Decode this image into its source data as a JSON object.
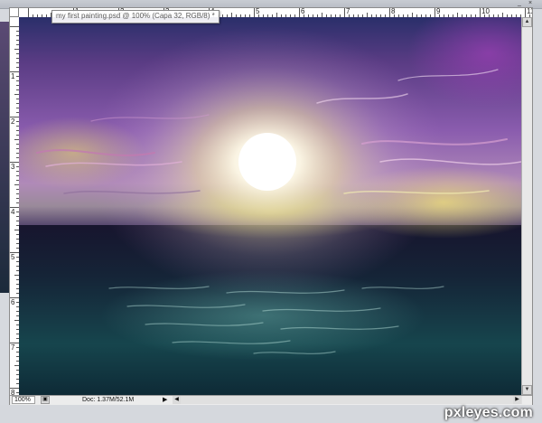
{
  "window": {
    "tooltip_title": "my first painting.psd @ 100% (Capa 32, RGB/8) *"
  },
  "rulers": {
    "top_labels": [
      "1",
      "2",
      "3",
      "4",
      "5",
      "6",
      "7",
      "8",
      "9",
      "10",
      "11"
    ],
    "left_labels": [
      "1",
      "2",
      "3",
      "4",
      "5",
      "6",
      "7",
      "8"
    ]
  },
  "status_bar": {
    "zoom": "100%",
    "doc_info": "Doc: 1.37M/52.1M",
    "arrow": "▶"
  },
  "watermark": {
    "text": "pxleyes.com"
  },
  "icons": {
    "status_icon": "▣",
    "scroll_up": "▲",
    "scroll_down": "▼",
    "scroll_left": "◀",
    "scroll_right": "▶",
    "minimize": "_",
    "close": "×"
  },
  "colors": {
    "sky_purple": "#7a4fa0",
    "sun": "#ffffff",
    "sea": "#0f2b3a",
    "horizon_yellow": "#e8d86a"
  }
}
